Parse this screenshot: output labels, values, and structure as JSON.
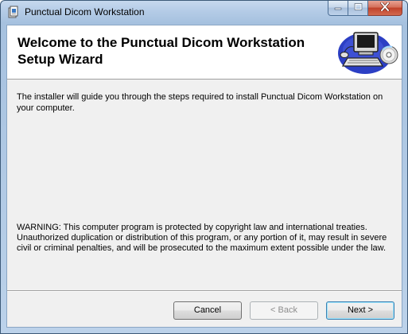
{
  "window": {
    "title": "Punctual Dicom Workstation"
  },
  "banner": {
    "title": "Welcome to the Punctual Dicom Workstation Setup Wizard"
  },
  "body": {
    "intro": "The installer will guide you through the steps required to install Punctual Dicom Workstation on your computer.",
    "warning": "WARNING: This computer program is protected by copyright law and international treaties. Unauthorized duplication or distribution of this program, or any portion of it, may result in severe civil or criminal penalties, and will be prosecuted to the maximum extent possible under the law."
  },
  "buttons": {
    "cancel": "Cancel",
    "back": "< Back",
    "next": "Next >"
  },
  "icons": {
    "app": "installer-package-icon",
    "banner": "computer-with-cd-icon",
    "minimize": "minimize-icon",
    "maximize": "maximize-icon",
    "close": "close-icon"
  },
  "colors": {
    "title_bar": "#b3cbe6",
    "close_button": "#c0422a",
    "dialog_background": "#f0f0f0",
    "banner_background": "#ffffff",
    "default_button_border": "#3c7fb1"
  }
}
